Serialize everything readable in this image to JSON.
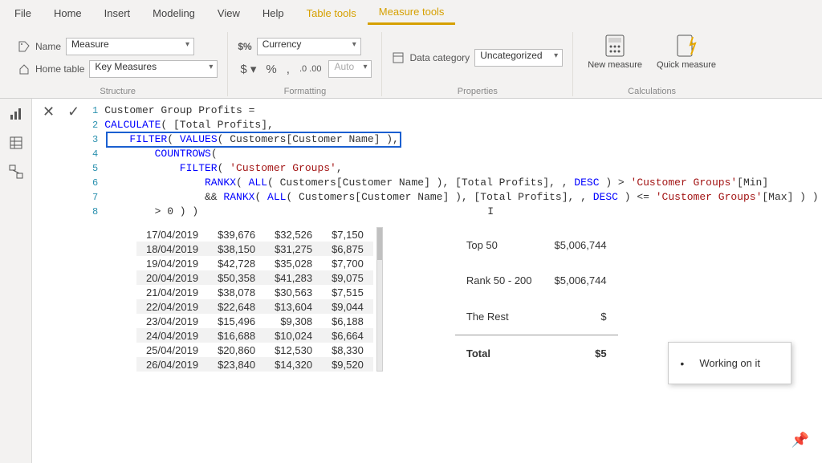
{
  "tabs": {
    "file": "File",
    "home": "Home",
    "insert": "Insert",
    "modeling": "Modeling",
    "view": "View",
    "help": "Help",
    "tabletools": "Table tools",
    "measuretools": "Measure tools"
  },
  "structure": {
    "name_label": "Name",
    "name_value": "Measure",
    "hometable_label": "Home table",
    "hometable_value": "Key Measures",
    "caption": "Structure"
  },
  "formatting": {
    "format_value": "Currency",
    "auto": "Auto",
    "caption": "Formatting"
  },
  "properties": {
    "datacat_label": "Data category",
    "datacat_value": "Uncategorized",
    "caption": "Properties"
  },
  "calculations": {
    "new_measure": "New measure",
    "quick_measure": "Quick measure",
    "caption": "Calculations"
  },
  "formula": {
    "l1": "Customer Group Profits =",
    "l2a": "CALCULATE",
    "l2b": "( [Total Profits],",
    "l3a": "    FILTER",
    "l3b": "( ",
    "l3c": "VALUES",
    "l3d": "( Customers[Customer Name] ),",
    "l4a": "        COUNTROWS",
    "l4b": "(",
    "l5a": "            FILTER",
    "l5b": "( ",
    "l5c": "'Customer Groups'",
    "l5d": ",",
    "l6a": "                RANKX",
    "l6b": "( ",
    "l6c": "ALL",
    "l6d": "( Customers[Customer Name] ), [Total Profits], , ",
    "l6e": "DESC",
    "l6f": " ) > ",
    "l6g": "'Customer Groups'",
    "l6h": "[Min]",
    "l7a": "                && ",
    "l7b": "RANKX",
    "l7c": "( ",
    "l7d": "ALL",
    "l7e": "( Customers[Customer Name] ), [Total Profits], , ",
    "l7f": "DESC",
    "l7g": " ) <= ",
    "l7h": "'Customer Groups'",
    "l7i": "[Max] ) )",
    "l8": "        > 0 ) )"
  },
  "table_rows": [
    {
      "d": "17/04/2019",
      "a": "$39,676",
      "b": "$32,526",
      "c": "$7,150"
    },
    {
      "d": "18/04/2019",
      "a": "$38,150",
      "b": "$31,275",
      "c": "$6,875"
    },
    {
      "d": "19/04/2019",
      "a": "$42,728",
      "b": "$35,028",
      "c": "$7,700"
    },
    {
      "d": "20/04/2019",
      "a": "$50,358",
      "b": "$41,283",
      "c": "$9,075"
    },
    {
      "d": "21/04/2019",
      "a": "$38,078",
      "b": "$30,563",
      "c": "$7,515"
    },
    {
      "d": "22/04/2019",
      "a": "$22,648",
      "b": "$13,604",
      "c": "$9,044"
    },
    {
      "d": "23/04/2019",
      "a": "$15,496",
      "b": "$9,308",
      "c": "$6,188"
    },
    {
      "d": "24/04/2019",
      "a": "$16,688",
      "b": "$10,024",
      "c": "$6,664"
    },
    {
      "d": "25/04/2019",
      "a": "$20,860",
      "b": "$12,530",
      "c": "$8,330"
    },
    {
      "d": "26/04/2019",
      "a": "$23,840",
      "b": "$14,320",
      "c": "$9,520"
    }
  ],
  "summary": {
    "r1l": "Top 50",
    "r1v": "$5,006,744",
    "r2l": "Rank 50 - 200",
    "r2v": "$5,006,744",
    "r3l": "The Rest",
    "r3v": "$",
    "totl": "Total",
    "totv": "$5"
  },
  "tooltip": "Working on it"
}
